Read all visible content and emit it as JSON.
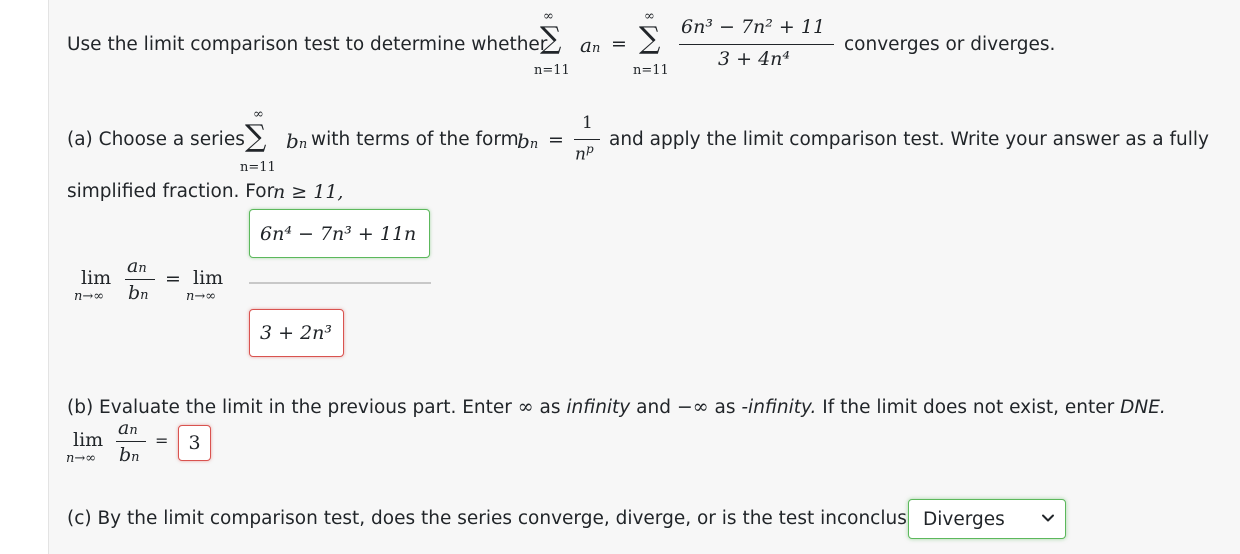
{
  "question": {
    "intro": "Use the limit comparison test to determine whether",
    "outro": "converges or diverges.",
    "sum_top": "∞",
    "sum_bottom": "n=11",
    "sum_term": "a",
    "sum_term_sub": "n",
    "series_numerator": "6n³ − 7n² + 11",
    "series_denominator": "3 + 4n⁴"
  },
  "part_a": {
    "prefix": "(a) Choose a series",
    "sum_term": "b",
    "sum_term_sub": "n",
    "middle": "with terms of the form",
    "bn_fraction_numerator": "1",
    "bn_fraction_denominator": "n^p",
    "suffix": "and apply the limit comparison test. Write your answer as a fully",
    "line2": "simplified fraction. For",
    "condition": "n ≥ 11,",
    "lim_word": "lim",
    "lim_sub": "n→∞",
    "ratio_num": "a",
    "ratio_num_sub": "n",
    "ratio_den": "b",
    "ratio_den_sub": "n",
    "numerator_answer": "6n⁴ − 7n³ + 11n",
    "denominator_answer": "3 + 2n³"
  },
  "part_b": {
    "text_1": "(b) Evaluate the limit in the previous part. Enter",
    "infinity_symbol": "∞",
    "text_2": "as",
    "infinity_word": "infinity",
    "text_3": "and",
    "neg_infinity_symbol": "−∞",
    "text_4": "as",
    "neg_infinity_word": "-infinity.",
    "text_5": "If the limit does not exist, enter",
    "dne_word": "DNE.",
    "answer": "3"
  },
  "part_c": {
    "question": "(c) By the limit comparison test, does the series converge, diverge, or is the test inconclusive?",
    "selected": "Diverges"
  }
}
